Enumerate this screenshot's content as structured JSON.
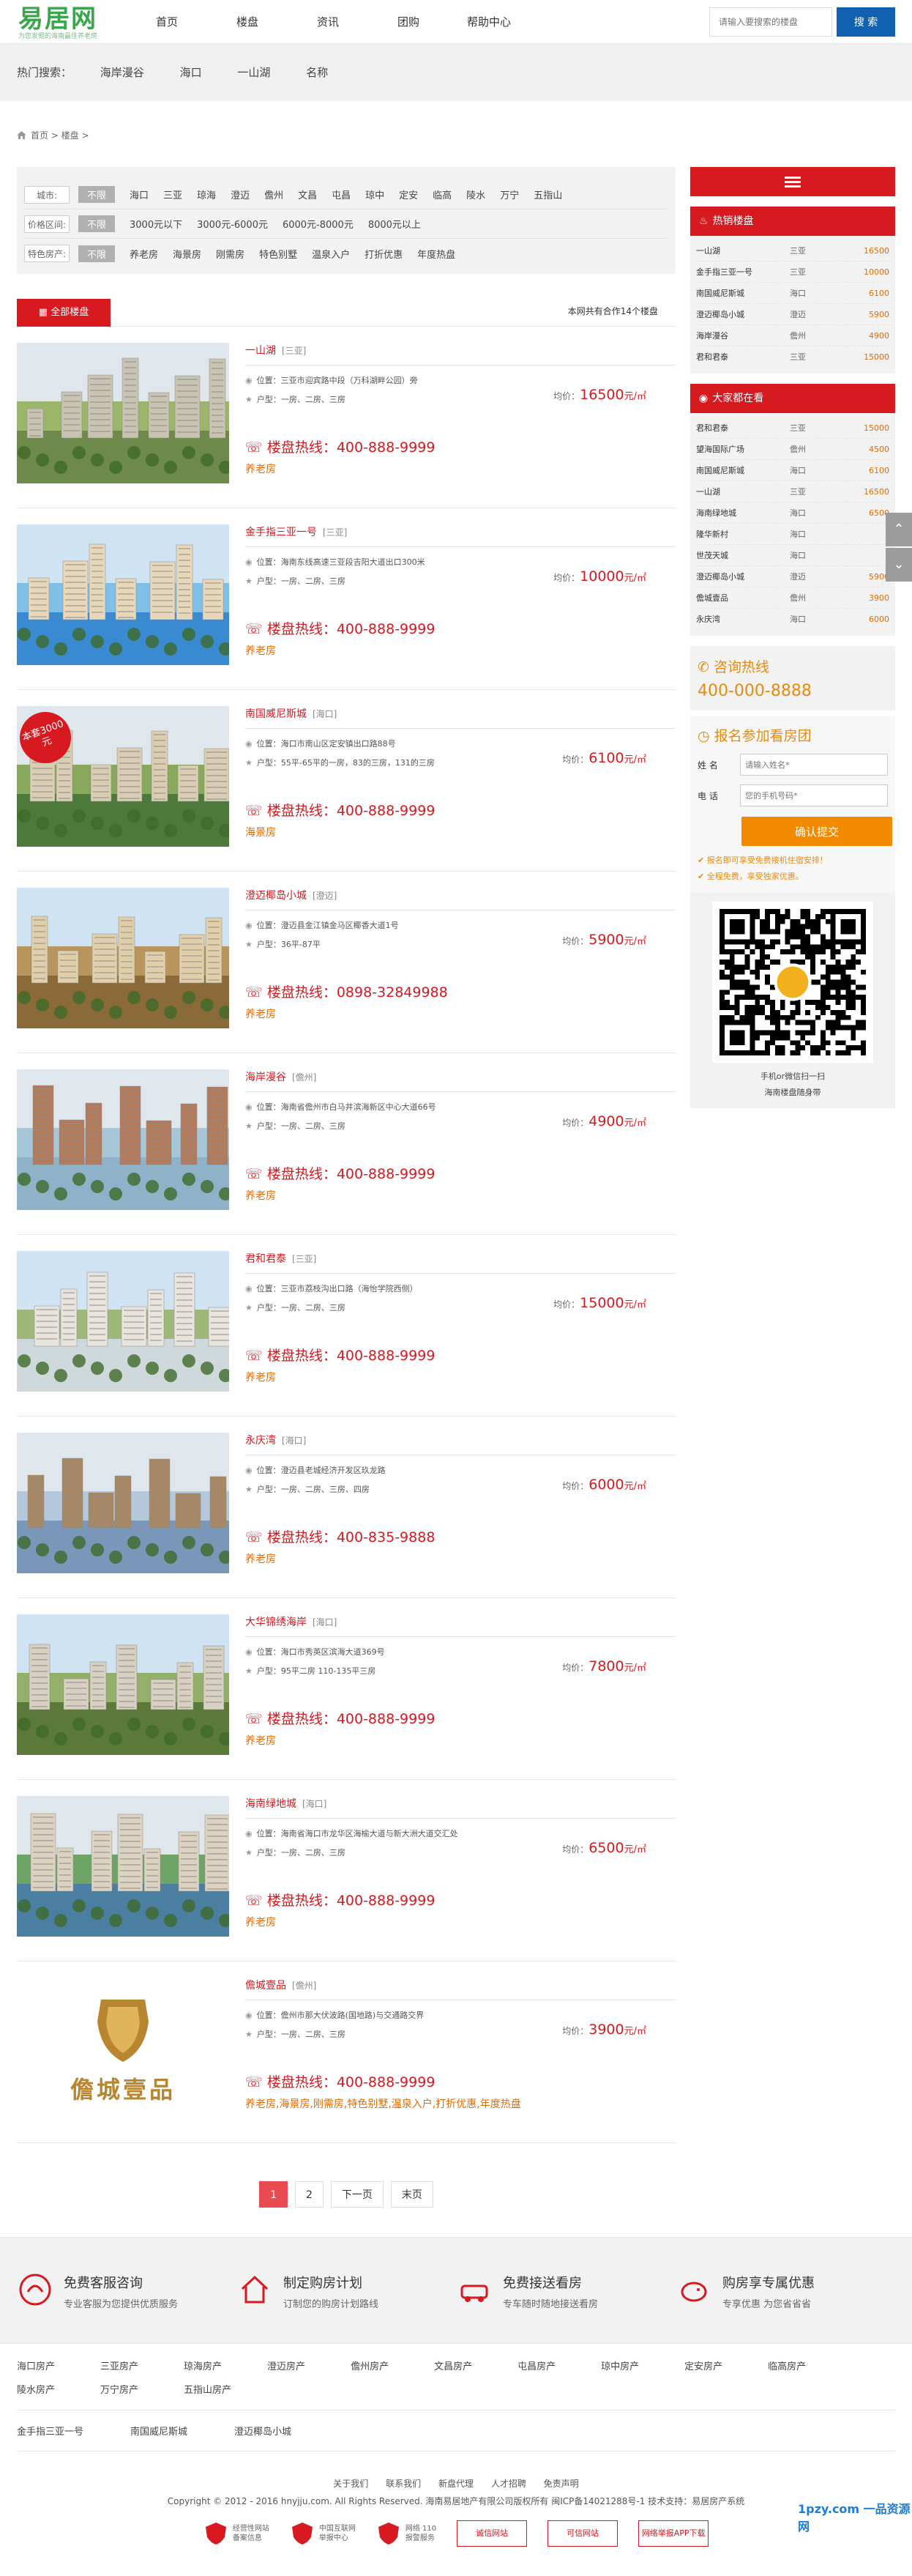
{
  "header": {
    "logo_text": "易居网",
    "logo_sub": "为您发掘的海南最佳养老房",
    "nav": [
      "首页",
      "楼盘",
      "资讯",
      "团购",
      "帮助中心"
    ],
    "search_placeholder": "请输入要搜索的楼盘",
    "search_button": "搜 索"
  },
  "hot": {
    "label": "热门搜索：",
    "items": [
      "海岸漫谷",
      "海口",
      "一山湖",
      "名称"
    ]
  },
  "breadcrumb": "首页 > 楼盘 >",
  "filters": [
    {
      "label": "城市:",
      "selected": "不限",
      "options": [
        "海口",
        "三亚",
        "琼海",
        "澄迈",
        "儋州",
        "文昌",
        "屯昌",
        "琼中",
        "定安",
        "临高",
        "陵水",
        "万宁",
        "五指山"
      ]
    },
    {
      "label": "价格区间:",
      "selected": "不限",
      "options": [
        "3000元以下",
        "3000元-6000元",
        "6000元-8000元",
        "8000元以上"
      ]
    },
    {
      "label": "特色房产:",
      "selected": "不限",
      "options": [
        "养老房",
        "海景房",
        "刚需房",
        "特色别墅",
        "温泉入户",
        "打折优惠",
        "年度热盘"
      ]
    }
  ],
  "list_head": {
    "tab": "全部楼盘",
    "count": "本网共有合作14个楼盘"
  },
  "labels": {
    "location": "位置：",
    "type": "户型：",
    "price_prefix": "均价：",
    "price_unit": "元/㎡"
  },
  "listings": [
    {
      "name": "一山湖",
      "area": "[三亚]",
      "location": "三亚市迎宾路中段（万科湖畔公园）旁",
      "type": "一房、二房、三房",
      "price": "16500",
      "tel": "楼盘热线：400-888-9999",
      "tag": "养老房"
    },
    {
      "name": "金手指三亚一号",
      "area": "[三亚]",
      "location": "海南东线高速三亚段吉阳大道出口300米",
      "type": "一房、二房、三房",
      "price": "10000",
      "tel": "楼盘热线：400-888-9999",
      "tag": "养老房"
    },
    {
      "name": "南国威尼斯城",
      "area": "[海口]",
      "location": "海口市南山区定安镇出口路88号",
      "type": "55平-65平的一房，83的三房，131的三房",
      "price": "6100",
      "tel": "楼盘热线：400-888-9999",
      "tag": "海景房",
      "badge": "本套3000元"
    },
    {
      "name": "澄迈椰岛小城",
      "area": "[澄迈]",
      "location": "澄迈县金江镇金马区椰香大道1号",
      "type": "36平-87平",
      "price": "5900",
      "tel": "楼盘热线：0898-32849988",
      "tag": "养老房"
    },
    {
      "name": "海岸漫谷",
      "area": "[儋州]",
      "location": "海南省儋州市白马井滨海新区中心大道66号",
      "type": "一房、二房、三房",
      "price": "4900",
      "tel": "楼盘热线：400-888-9999",
      "tag": "养老房"
    },
    {
      "name": "君和君泰",
      "area": "[三亚]",
      "location": "三亚市荔枝沟出口路（海怡学院西侧）",
      "type": "一房、二房、三房",
      "price": "15000",
      "tel": "楼盘热线：400-888-9999",
      "tag": "养老房"
    },
    {
      "name": "永庆湾",
      "area": "[海口]",
      "location": "澄迈县老城经济开发区玖龙路",
      "type": "一房、二房、三房、四房",
      "price": "6000",
      "tel": "楼盘热线：400-835-9888",
      "tag": "养老房"
    },
    {
      "name": "大华锦绣海岸",
      "area": "[海口]",
      "location": "海口市秀英区滨海大道369号",
      "type": "95平二房 110-135平三房",
      "price": "7800",
      "tel": "楼盘热线：400-888-9999",
      "tag": "养老房"
    },
    {
      "name": "海南绿地城",
      "area": "[海口]",
      "location": "海南省海口市龙华区海榆大道与新大洲大道交汇处",
      "type": "一房、二房、三房",
      "price": "6500",
      "tel": "楼盘热线：400-888-9999",
      "tag": "养老房"
    },
    {
      "name": "儋城壹品",
      "area": "[儋州]",
      "location": "儋州市那大伏波路(国地路)与交通路交界",
      "type": "一房、二房、三房",
      "price": "3900",
      "tel": "楼盘热线：400-888-9999",
      "tag": "养老房,海景房,刚需房,特色别墅,温泉入户,打折优惠,年度热盘",
      "logo_text": "儋城壹品"
    }
  ],
  "pager": [
    "1",
    "2",
    "下一页",
    "末页"
  ],
  "hot_box": {
    "title": "热销楼盘",
    "rows": [
      [
        "一山湖",
        "三亚",
        "16500"
      ],
      [
        "金手指三亚一号",
        "三亚",
        "10000"
      ],
      [
        "南国威尼斯城",
        "海口",
        "6100"
      ],
      [
        "澄迈椰岛小城",
        "澄迈",
        "5900"
      ],
      [
        "海岸漫谷",
        "儋州",
        "4900"
      ],
      [
        "君和君泰",
        "三亚",
        "15000"
      ]
    ]
  },
  "watch_box": {
    "title": "大家都在看",
    "rows": [
      [
        "君和君泰",
        "三亚",
        "15000"
      ],
      [
        "望海国际广场",
        "儋州",
        "4500"
      ],
      [
        "南国威尼斯城",
        "海口",
        "6100"
      ],
      [
        "一山湖",
        "三亚",
        "16500"
      ],
      [
        "海南绿地城",
        "海口",
        "6500"
      ],
      [
        "隆华新村",
        "海口",
        ""
      ],
      [
        "世茂天城",
        "海口",
        ""
      ],
      [
        "澄迈椰岛小城",
        "澄迈",
        "5900"
      ],
      [
        "儋城壹品",
        "儋州",
        "3900"
      ],
      [
        "永庆湾",
        "海口",
        "6000"
      ]
    ]
  },
  "hotline": {
    "title": "咨询热线",
    "number": "400-000-8888"
  },
  "apply": {
    "title": "报名参加看房团",
    "name_label": "姓 名",
    "name_placeholder": "请输入姓名*",
    "phone_label": "电 话",
    "phone_placeholder": "您的手机号码*",
    "submit": "确认提交",
    "note1": "✔ 报名即可享受免费接机住宿安排！",
    "note2": "✔ 全程免费，享受独家优惠。"
  },
  "qr": {
    "cap1": "手机or微信扫一扫",
    "cap2": "海南楼盘随身带"
  },
  "features": [
    {
      "t1": "免费客服咨询",
      "t2": "专业客服为您提供优质服务",
      "icon": "headset-icon"
    },
    {
      "t1": "制定购房计划",
      "t2": "订制您的购房计划路线",
      "icon": "house-icon"
    },
    {
      "t1": "免费接送看房",
      "t2": "专车随时随地接送看房",
      "icon": "car-icon"
    },
    {
      "t1": "购房享专属优惠",
      "t2": "专享优惠 为您省省省",
      "icon": "piggy-icon"
    }
  ],
  "city_links": [
    "海口房产",
    "三亚房产",
    "琼海房产",
    "澄迈房产",
    "儋州房产",
    "文昌房产",
    "屯昌房产",
    "琼中房产",
    "定安房产",
    "临高房产",
    "陵水房产",
    "万宁房产",
    "五指山房产"
  ],
  "friend_links": [
    "金手指三亚一号",
    "南国威尼斯城",
    "澄迈椰岛小城"
  ],
  "footer": {
    "links": [
      "关于我们",
      "联系我们",
      "新盘代理",
      "人才招聘",
      "免责声明"
    ],
    "copyright": "Copyright © 2012 - 2016 hnyjju.com. All Rights Reserved. 海南易居地产有限公司版权所有    闽ICP备14021288号-1    技术支持：易居房产系统",
    "badges": [
      {
        "l1": "经营性网站",
        "l2": "备案信息"
      },
      {
        "l1": "中国互联网",
        "l2": "举报中心"
      },
      {
        "l1": "网络 110",
        "l2": "报警服务"
      },
      {
        "red": "诚信网站"
      },
      {
        "red": "可信网站"
      },
      {
        "red": "网络举报APP下载"
      }
    ]
  },
  "watermark": "1pzy.com 一品资源网"
}
